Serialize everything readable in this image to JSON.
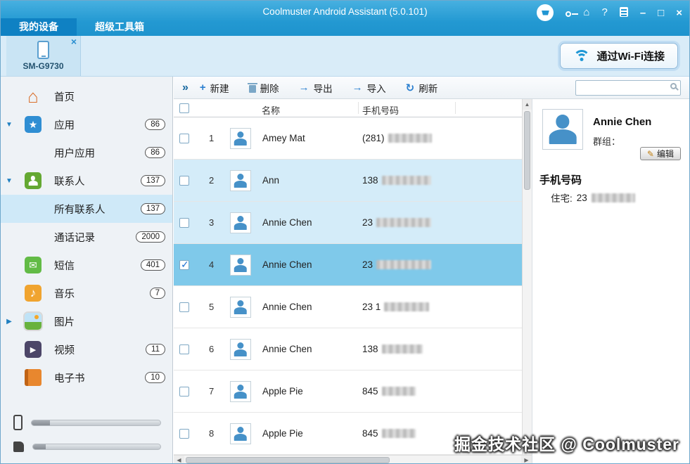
{
  "window": {
    "title": "Coolmuster Android Assistant (5.0.101)"
  },
  "icons": {
    "home": "⌂",
    "help": "?",
    "minimize": "–",
    "maximize": "□",
    "close": "×",
    "chevrons": "»",
    "plus": "+",
    "arrow_export": "→",
    "arrow_import": "→",
    "refresh": "↻",
    "expand_down": "▼",
    "expand_right": "▶",
    "star": "★",
    "mail": "✉",
    "note": "♪",
    "play": "▶",
    "edit": "✎",
    "house": "⌂",
    "device_close": "×",
    "scroll_up": "▲",
    "scroll_down": "▼",
    "scroll_left": "◀",
    "scroll_right": "▶"
  },
  "tabs": [
    {
      "label": "我的设备"
    },
    {
      "label": "超级工具箱"
    }
  ],
  "device": {
    "name": "SM-G9730",
    "wifi_button": "通过Wi-Fi连接"
  },
  "sidebar": {
    "items": [
      {
        "label": "首页"
      },
      {
        "label": "应用",
        "badge": "86"
      },
      {
        "label": "用户应用",
        "badge": "86"
      },
      {
        "label": "联系人",
        "badge": "137"
      },
      {
        "label": "所有联系人",
        "badge": "137"
      },
      {
        "label": "通话记录",
        "badge": "2000"
      },
      {
        "label": "短信",
        "badge": "401"
      },
      {
        "label": "音乐",
        "badge": "7"
      },
      {
        "label": "图片"
      },
      {
        "label": "视频",
        "badge": "11"
      },
      {
        "label": "电子书",
        "badge": "10"
      }
    ]
  },
  "toolbar": {
    "new": "新建",
    "delete": "删除",
    "export": "导出",
    "import": "导入",
    "refresh": "刷新"
  },
  "table": {
    "header_name": "名称",
    "header_phone": "手机号码",
    "rows": [
      {
        "num": "1",
        "name": "Amey Mat",
        "phone_prefix": "(281)"
      },
      {
        "num": "2",
        "name": "Ann",
        "phone_prefix": "138"
      },
      {
        "num": "3",
        "name": "Annie Chen",
        "phone_prefix": "23"
      },
      {
        "num": "4",
        "name": "Annie Chen",
        "phone_prefix": "23"
      },
      {
        "num": "5",
        "name": "Annie Chen",
        "phone_prefix": "23 1"
      },
      {
        "num": "6",
        "name": "Annie Chen",
        "phone_prefix": "138"
      },
      {
        "num": "7",
        "name": "Apple Pie",
        "phone_prefix": "845"
      },
      {
        "num": "8",
        "name": "Apple Pie",
        "phone_prefix": "845"
      }
    ]
  },
  "detail": {
    "name": "Annie Chen",
    "group_label": "群组：",
    "edit_button": "编辑",
    "phone_section": "手机号码",
    "home_label": "住宅:",
    "home_prefix": "23"
  },
  "watermark": "掘金技术社区 @ Coolmuster"
}
